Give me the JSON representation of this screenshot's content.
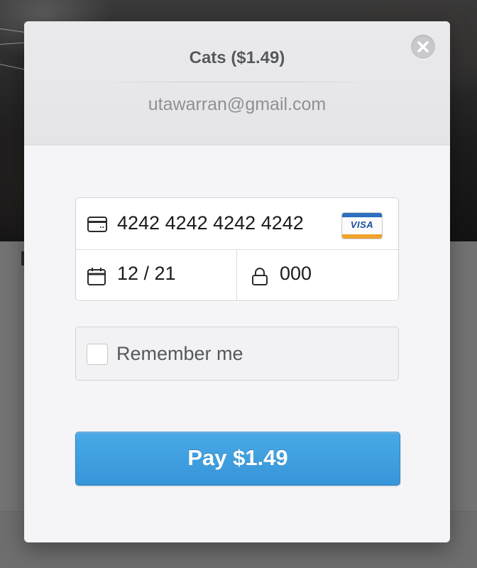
{
  "checkout": {
    "title": "Cats ($1.49)",
    "email": "utawarran@gmail.com",
    "card_number": "4242 4242 4242 4242",
    "card_brand": "VISA",
    "expiry": "12 / 21",
    "cvc": "000",
    "remember_label": "Remember me",
    "remember_checked": false,
    "pay_label": "Pay $1.49"
  },
  "icons": {
    "close": "close-icon",
    "card": "credit-card-icon",
    "calendar": "calendar-icon",
    "lock": "lock-icon",
    "brand": "visa-logo"
  },
  "colors": {
    "accent": "#3a9ce0",
    "overlay": "#737374",
    "modal": "#f5f5f7",
    "header": "#e7e7e9"
  }
}
